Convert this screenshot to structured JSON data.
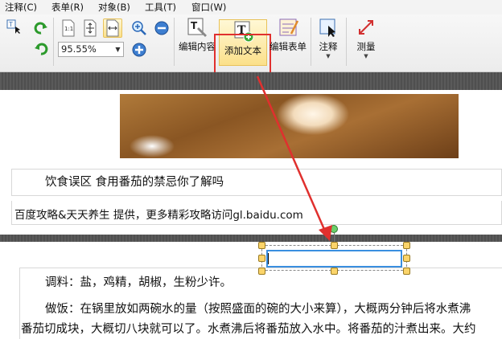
{
  "menu": [
    "注释(C)",
    "表单(R)",
    "对象(B)",
    "工具(T)",
    "窗口(W)"
  ],
  "toolbar": {
    "zoom_value": "95.55%",
    "buttons": {
      "edit_content": "编辑内容",
      "add_text": "添加文本",
      "edit_form": "编辑表单",
      "annotate": "注释",
      "measure": "测量"
    },
    "accent_highlight": "#e0302e"
  },
  "document": {
    "heading": "饮食误区 食用番茄的禁忌你了解吗",
    "source": "百度攻略&天天养生 提供，更多精彩攻略访问gl.baidu.com",
    "paragraph1": "调料：盐，鸡精，胡椒，生粉少许。",
    "paragraph2_line1": "做饭：在锅里放如两碗水的量（按照盛面的碗的大小来算），大概两分钟后将水煮沸",
    "paragraph2_line2": "番茄切成块，大概切八块就可以了。水煮沸后将番茄放入水中。将番茄的汁煮出来。大约"
  }
}
